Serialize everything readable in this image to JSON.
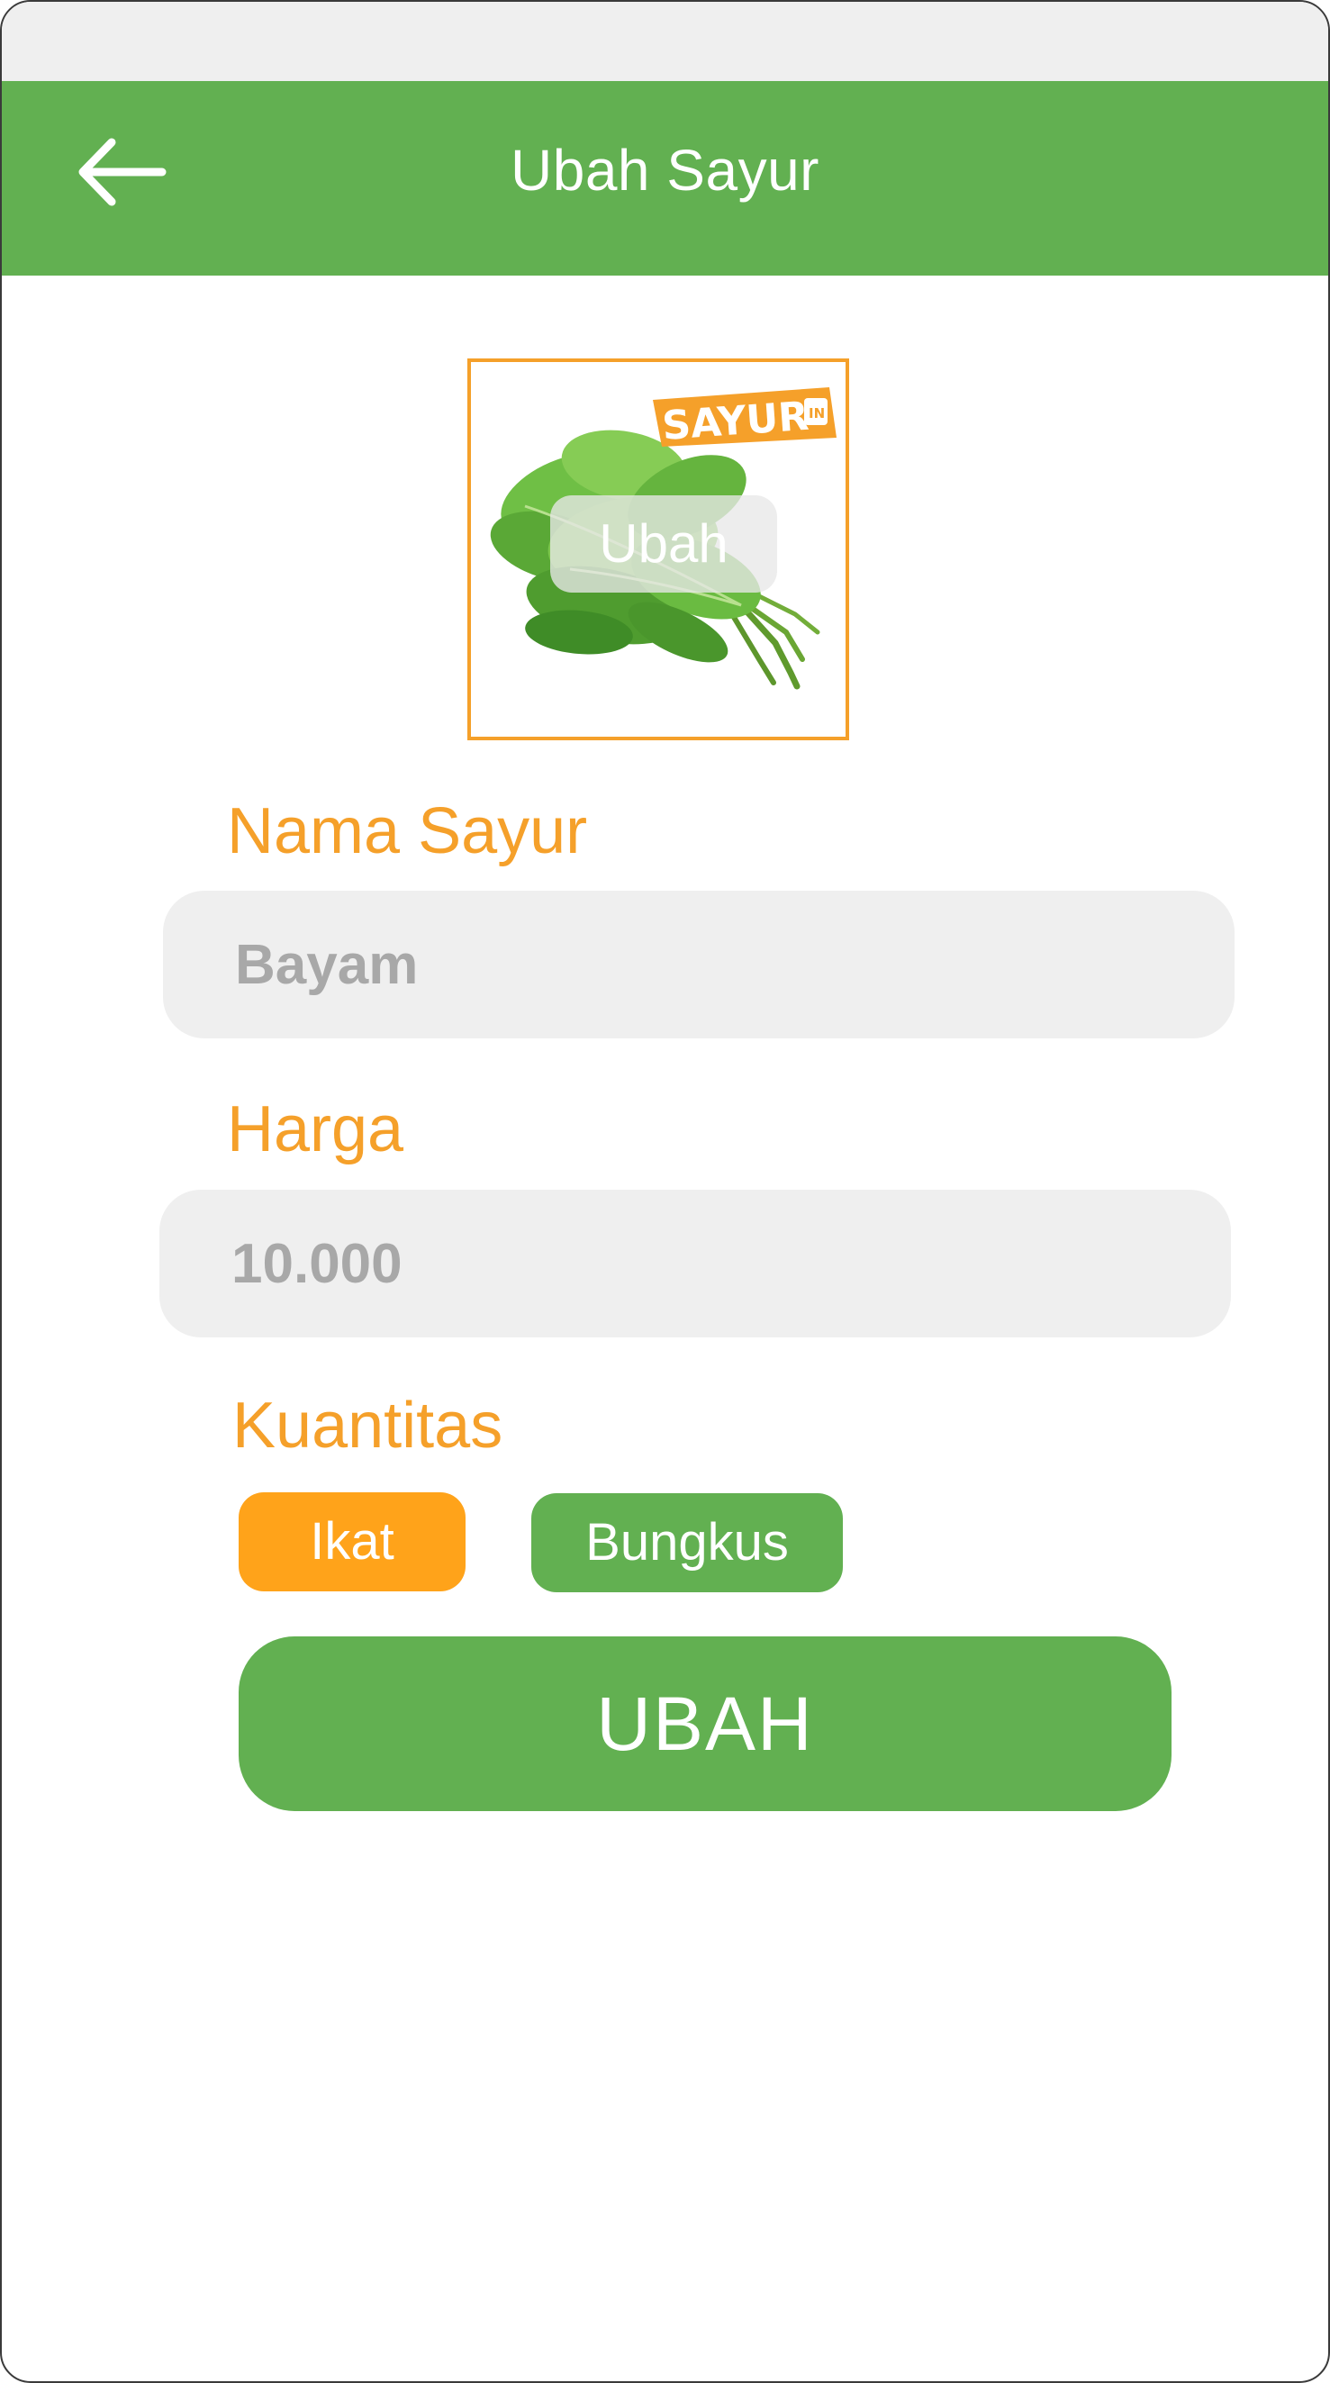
{
  "app_bar": {
    "title": "Ubah Sayur",
    "back_icon": "arrow-left-icon",
    "color": "#62b051"
  },
  "photo": {
    "change_label": "Ubah",
    "logo_text": "SAYUR IN",
    "border_color": "#f5a02a"
  },
  "form": {
    "name_label": "Nama Sayur",
    "name_value": "Bayam",
    "price_label": "Harga",
    "price_value": "10.000",
    "quantity_label": "Kuantitas",
    "quantity_options": [
      {
        "label": "Ikat",
        "selected": true,
        "color": "#ffa31a"
      },
      {
        "label": "Bungkus",
        "selected": false,
        "color": "#62b051"
      }
    ],
    "submit_label": "UBAH"
  },
  "colors": {
    "accent_orange": "#f5a02a",
    "primary_green": "#62b051",
    "input_bg": "#efefef",
    "input_text": "#a8a8a8"
  }
}
